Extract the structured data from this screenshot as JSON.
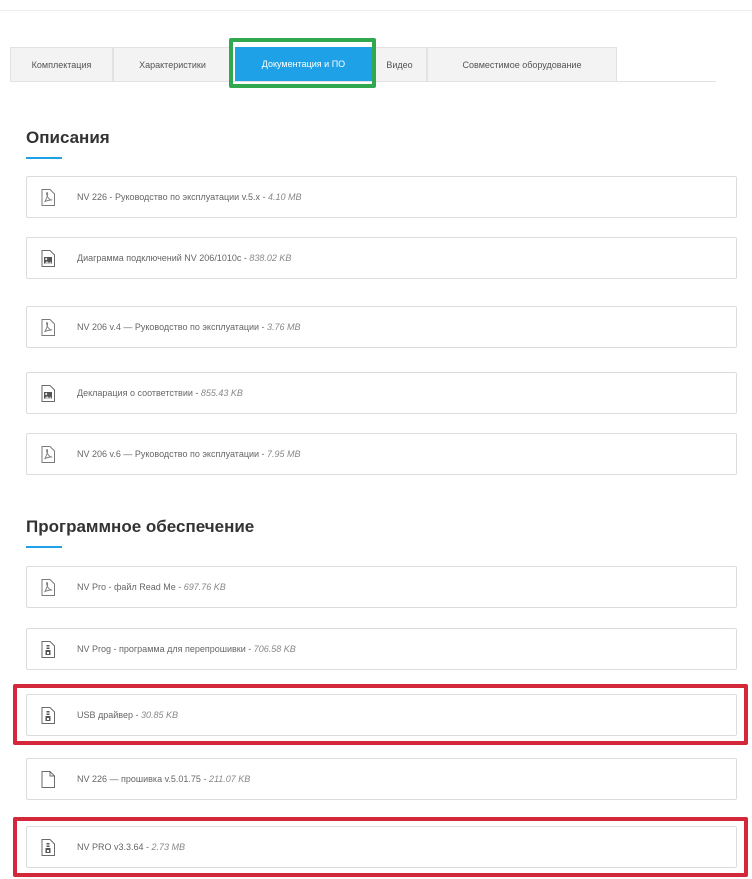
{
  "tabs": [
    {
      "label": "Комплектация"
    },
    {
      "label": "Характеристики"
    },
    {
      "label": "Документация и ПО"
    },
    {
      "label": "Видео"
    },
    {
      "label": "Совместимое оборудование"
    }
  ],
  "active_tab": "Документация и ПО",
  "sections": {
    "descriptions": {
      "title": "Описания",
      "items": [
        {
          "name": "NV 226 - Руководство по эксплуатации v.5.x",
          "size": "4.10 MB",
          "icon": "pdf-icon"
        },
        {
          "name": "Диаграмма подключений NV 206/1010с",
          "size": "838.02 KB",
          "icon": "image-file-icon"
        },
        {
          "name": "NV 206 v.4 — Руководство по эксплуатации",
          "size": "3.76 MB",
          "icon": "pdf-icon"
        },
        {
          "name": "Декларация о соответствии",
          "size": "855.43 KB",
          "icon": "image-file-icon"
        },
        {
          "name": "NV 206 v.6 — Руководство по эксплуатации",
          "size": "7.95 MB",
          "icon": "pdf-icon"
        }
      ]
    },
    "software": {
      "title": "Программное обеспечение",
      "items": [
        {
          "name": "NV Pro - файл Read Me",
          "size": "697.76 KB",
          "icon": "pdf-icon"
        },
        {
          "name": "NV Prog - программа для перепрошивки",
          "size": "706.58 KB",
          "icon": "archive-icon"
        },
        {
          "name": "USB драйвер",
          "size": "30.85 KB",
          "icon": "archive-icon"
        },
        {
          "name": "NV 226 — прошивка v.5.01.75",
          "size": "211.07 KB",
          "icon": "blank-file-icon"
        },
        {
          "name": "NV PRO v3.3.64",
          "size": "2.73 MB",
          "icon": "archive-icon"
        }
      ]
    }
  },
  "colors": {
    "accent": "#1ea1e6",
    "highlight_green": "#2fa84f",
    "highlight_red": "#d2283a"
  }
}
